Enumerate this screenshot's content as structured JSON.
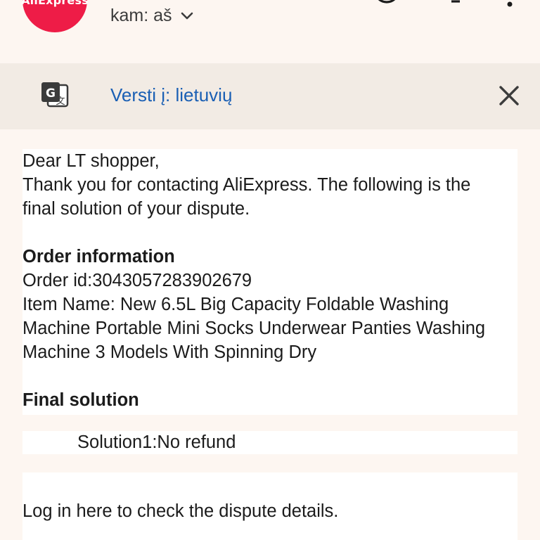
{
  "header": {
    "sender_logo_text": "AliExpress",
    "recipient_label": "kam: aš",
    "icons": [
      "emoji-icon",
      "reply-icon",
      "more-icon"
    ]
  },
  "translate_bar": {
    "translate_link": "Versti į: lietuvių"
  },
  "email": {
    "greeting": "Dear LT shopper,",
    "intro_line1": "Thank you for contacting AliExpress. The following is the",
    "intro_line2": "final solution of your dispute.",
    "order_heading": "Order information",
    "order_id": "Order id:3043057283902679",
    "item_line1": "Item Name: New 6.5L Big Capacity Foldable Washing",
    "item_line2": "Machine Portable Mini Socks Underwear Panties Washing",
    "item_line3": "Machine 3 Models With Spinning Dry",
    "final_heading": "Final solution",
    "solution": "Solution1:No refund",
    "login_line": "Log in here to check the dispute details."
  },
  "colors": {
    "background": "#fdf6f1",
    "translate_bar": "#f2ebe4",
    "link": "#1a5fb4",
    "brand": "#ee1c47"
  }
}
